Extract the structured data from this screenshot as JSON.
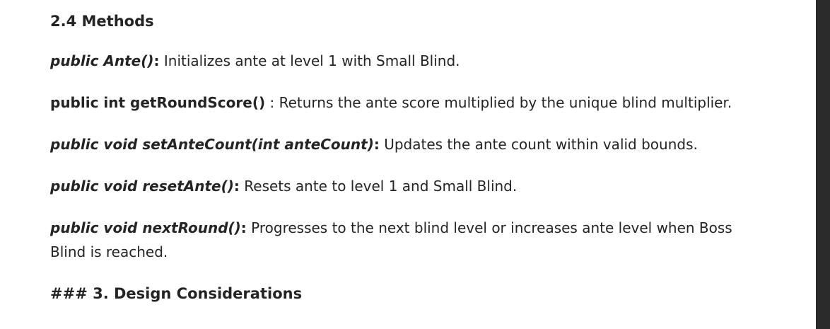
{
  "section": {
    "heading": "2.4 Methods"
  },
  "methods": [
    {
      "signature": "public Ante()",
      "separator": ":",
      "description": " Initializes ante at level 1 with Small Blind."
    },
    {
      "signature": "public int getRoundScore()",
      "separator": " :",
      "description": " Returns the ante score multiplied by the unique blind multiplier."
    },
    {
      "signature": "public void setAnteCount(int anteCount)",
      "separator": ":",
      "description": " Updates the ante count within valid bounds."
    },
    {
      "signature": "public void resetAnte()",
      "separator": ":",
      "description": " Resets ante to level 1 and Small Blind."
    },
    {
      "signature": "public void nextRound()",
      "separator": ":",
      "description": " Progresses to the next blind level or increases ante level when Boss Blind is reached."
    }
  ],
  "next_heading": "### 3. Design Considerations"
}
